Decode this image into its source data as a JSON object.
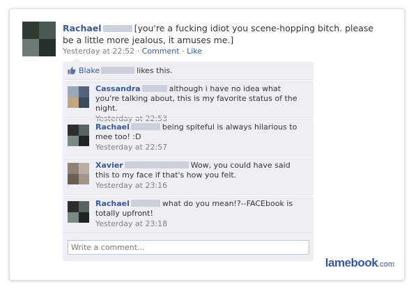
{
  "status": {
    "author": "Rachael",
    "text": "[you're a fucking idiot you scene-hopping bitch. please be a little more jealous, it amuses me.]",
    "timestamp": "Yesterday at 22:52",
    "separator": " · ",
    "comment_label": "Comment",
    "like_label": "Like"
  },
  "likes": {
    "name": "Blake",
    "suffix": "likes this.",
    "icon": "thumbs-up-icon"
  },
  "comments": [
    {
      "author": "Cassandra",
      "text": "although i have no idea what you're talking about, this is my favorite status of the night.",
      "time": "Yesterday at 22:53"
    },
    {
      "author": "Rachael",
      "text": "being spiteful is always hilarious to mee too! :D",
      "time": "Yesterday at 22:57"
    },
    {
      "author": "Xavier",
      "text": "Wow, you could have said this to my face if that's how you felt.",
      "time": "Yesterday at 23:16"
    },
    {
      "author": "Rachael",
      "text": "what do you mean!?--FACEbook is totally upfront!",
      "time": "Yesterday at 23:18"
    }
  ],
  "write_comment": {
    "placeholder": "Write a comment..."
  },
  "watermark": {
    "brand": "lamebook",
    "tld": ".com"
  },
  "colors": {
    "link": "#3b5998",
    "thread_bg": "#edeff4",
    "meta": "#808080"
  }
}
